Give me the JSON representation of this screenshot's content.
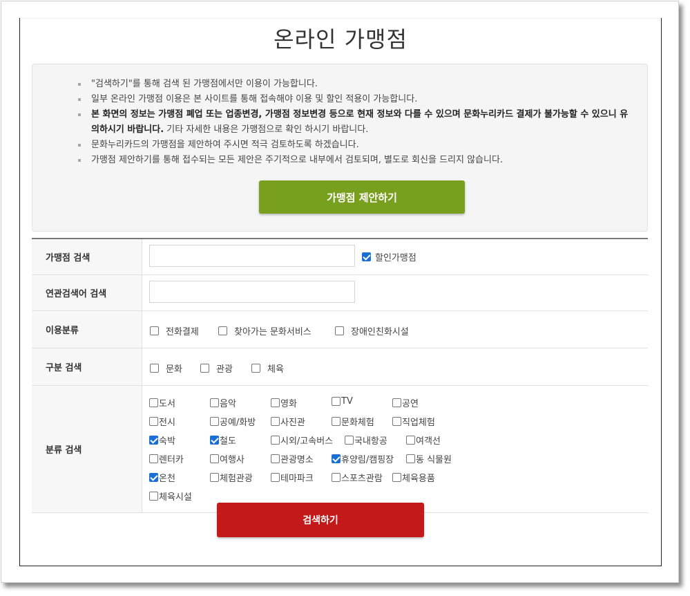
{
  "page": {
    "title": "온라인 가맹점"
  },
  "notice": {
    "items": [
      "\"검색하기\"를 통해 검색 된 가맹점에서만 이용이 가능합니다.",
      "일부 온라인 가맹점 이용은 본 사이트를 통해 접속해야 이용 및 할인 적용이 가능합니다.",
      "문화누리카드의 가맹점을 제안하여 주시면 적극 검토하도록 하겠습니다.",
      "가맹점 제안하기를 통해 접수되는 모든 제안은 주기적으로 내부에서 검토되며, 별도로 회신을 드리지 않습니다."
    ],
    "bold_item": {
      "bold": "본 화면의 정보는 가맹점 폐업 또는 업종변경, 가맹점 정보변경 등으로 현재 정보와 다를 수 있으며 문화누리카드 결제가 불가능할 수 있으니 유의하시기 바랍니다.",
      "normal": " 기타 자세한 내용은 가맹점으로 확인 하시기 바랍니다."
    },
    "suggest_label": "가맹점 제안하기"
  },
  "form": {
    "store_search_label": "가맹점 검색",
    "store_search_value": "",
    "discount_label": "할인가맹점",
    "discount_checked": true,
    "related_label": "연관검색어 검색",
    "related_value": "",
    "usage_label": "이용분류",
    "usage_options": [
      {
        "label": "전화결제",
        "checked": false
      },
      {
        "label": "찾아가는 문화서비스",
        "checked": false
      },
      {
        "label": "장애인친화시설",
        "checked": false
      }
    ],
    "division_label": "구분 검색",
    "division_options": [
      {
        "label": "문화",
        "checked": false
      },
      {
        "label": "관광",
        "checked": false
      },
      {
        "label": "체육",
        "checked": false
      }
    ],
    "category_label": "분류 검색",
    "category_options": [
      {
        "label": "도서",
        "checked": false
      },
      {
        "label": "음악",
        "checked": false
      },
      {
        "label": "영화",
        "checked": false
      },
      {
        "label": "TV",
        "checked": false
      },
      {
        "label": "공연",
        "checked": false
      },
      {
        "label": "전시",
        "checked": false
      },
      {
        "label": "공예/화방",
        "checked": false
      },
      {
        "label": "사진관",
        "checked": false
      },
      {
        "label": "문화체험",
        "checked": false
      },
      {
        "label": "직업체험",
        "checked": false
      },
      {
        "label": "숙박",
        "checked": true
      },
      {
        "label": "철도",
        "checked": true
      },
      {
        "label": "시외/고속버스",
        "checked": false
      },
      {
        "label": "국내항공",
        "checked": false
      },
      {
        "label": "여객선",
        "checked": false
      },
      {
        "label": "렌터카",
        "checked": false
      },
      {
        "label": "여행사",
        "checked": false
      },
      {
        "label": "관광명소",
        "checked": false
      },
      {
        "label": "휴양림/캠핑장",
        "checked": true
      },
      {
        "label": "동 식물원",
        "checked": false
      },
      {
        "label": "온천",
        "checked": true
      },
      {
        "label": "체험관광",
        "checked": false
      },
      {
        "label": "테마파크",
        "checked": false
      },
      {
        "label": "스포츠관람",
        "checked": false
      },
      {
        "label": "체육용품",
        "checked": false
      },
      {
        "label": "체육시설",
        "checked": false
      }
    ],
    "search_label": "검색하기"
  },
  "colors": {
    "suggest_button": "#78a01e",
    "search_button": "#c4191a",
    "checkbox_checked": "#1a6fd4"
  }
}
